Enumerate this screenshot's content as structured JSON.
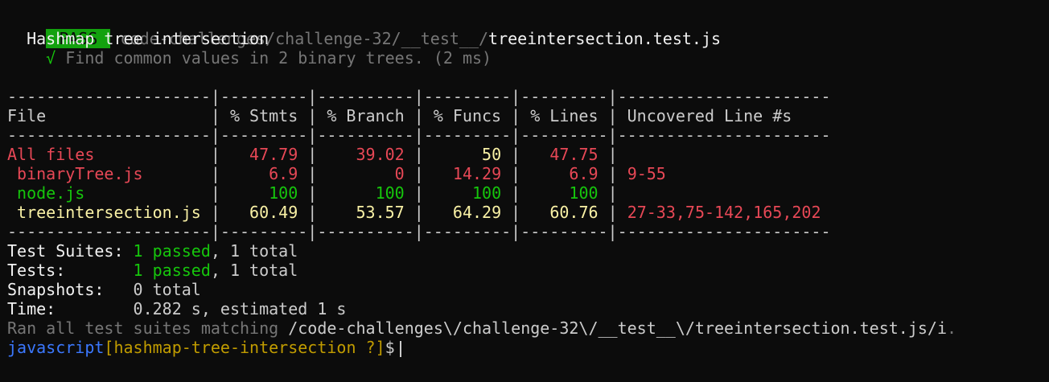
{
  "header": {
    "badge": "PASS",
    "path_dim": "code-challenges/challenge-32/__test__/",
    "path_file": "treeintersection.test.js",
    "suite": "  Hashmap tree intersection",
    "test_check": "    √",
    "test_name": " Find common values in 2 binary trees. (2 ms)"
  },
  "coverage": {
    "separator": "---------------------|---------|----------|---------|---------|----------------------",
    "header": "File                 | % Stmts | % Branch | % Funcs | % Lines | Uncovered Line #s",
    "rows": [
      {
        "file": "All files",
        "f_cls": "red",
        "stmts": "47.79",
        "s_cls": "red",
        "branch": "39.02",
        "b_cls": "red",
        "funcs": "50",
        "fn_cls": "yellow",
        "lines": "47.75",
        "l_cls": "red",
        "uncovered": "",
        "u_cls": "red"
      },
      {
        "file": " binaryTree.js",
        "f_cls": "red",
        "stmts": "6.9",
        "s_cls": "red",
        "branch": "0",
        "b_cls": "red",
        "funcs": "14.29",
        "fn_cls": "red",
        "lines": "6.9",
        "l_cls": "red",
        "uncovered": "9-55",
        "u_cls": "red"
      },
      {
        "file": " node.js",
        "f_cls": "green",
        "stmts": "100",
        "s_cls": "green",
        "branch": "100",
        "b_cls": "green",
        "funcs": "100",
        "fn_cls": "green",
        "lines": "100",
        "l_cls": "green",
        "uncovered": "",
        "u_cls": "red"
      },
      {
        "file": " treeintersection.js",
        "f_cls": "yellow",
        "stmts": "60.49",
        "s_cls": "yellow",
        "branch": "53.57",
        "b_cls": "yellow",
        "funcs": "64.29",
        "fn_cls": "yellow",
        "lines": "60.76",
        "l_cls": "yellow",
        "uncovered": "27-33,75-142,165,202",
        "u_cls": "red"
      }
    ]
  },
  "summary": {
    "suites_label": "Test Suites: ",
    "suites_passed": "1 passed",
    "suites_total": ", 1 total",
    "tests_label": "Tests:       ",
    "tests_passed": "1 passed",
    "tests_total": ", 1 total",
    "snapshots_label": "Snapshots:   ",
    "snapshots_value": "0 total",
    "time_label": "Time:        ",
    "time_value": "0.282 s, estimated 1 s",
    "ran_dim": "Ran all test suites matching ",
    "ran_pattern": "/code-challenges\\/challenge-32\\/__test__\\/treeintersection.test.js/i",
    "ran_end": "."
  },
  "prompt": {
    "shell": "javascript",
    "branch": "[hashmap-tree-intersection ?]",
    "symbol": "$"
  }
}
